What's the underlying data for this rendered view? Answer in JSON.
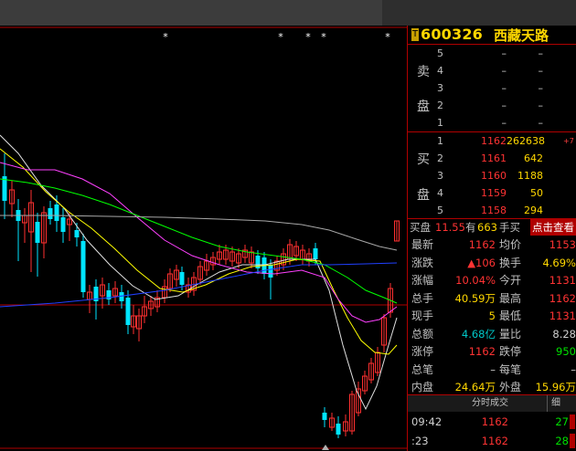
{
  "quote": {
    "flag": "T",
    "code": "600326",
    "name": "西藏天路",
    "sell_label_1": "卖",
    "sell_label_2": "盘",
    "buy_label_1": "买",
    "buy_label_2": "盘",
    "sell_levels": [
      {
        "n": "5",
        "price": "–",
        "vol": "–"
      },
      {
        "n": "4",
        "price": "–",
        "vol": "–"
      },
      {
        "n": "3",
        "price": "–",
        "vol": "–"
      },
      {
        "n": "2",
        "price": "–",
        "vol": "–"
      },
      {
        "n": "1",
        "price": "–",
        "vol": "–"
      }
    ],
    "buy_levels": [
      {
        "n": "1",
        "price": "1162",
        "vol": "262638",
        "chg": "+7"
      },
      {
        "n": "2",
        "price": "1161",
        "vol": "642",
        "chg": ""
      },
      {
        "n": "3",
        "price": "1160",
        "vol": "1188",
        "chg": ""
      },
      {
        "n": "4",
        "price": "1159",
        "vol": "50",
        "chg": ""
      },
      {
        "n": "5",
        "price": "1158",
        "vol": "294",
        "chg": ""
      }
    ],
    "buy_pan": {
      "label": "买盘",
      "value": "11.55",
      "has": "有",
      "count": "663",
      "unit": "手买",
      "button": "点击查看"
    },
    "stats": [
      {
        "l1": "最新",
        "v1": "1162",
        "c1": "red",
        "l2": "均价",
        "v2": "1153",
        "c2": "red"
      },
      {
        "l1": "涨跌",
        "v1": "▲106",
        "c1": "red",
        "l2": "换手",
        "v2": "4.69%",
        "c2": "yel"
      },
      {
        "l1": "涨幅",
        "v1": "10.04%",
        "c1": "red",
        "l2": "今开",
        "v2": "1131",
        "c2": "red"
      },
      {
        "l1": "总手",
        "v1": "40.59万",
        "c1": "yel",
        "l2": "最高",
        "v2": "1162",
        "c2": "red"
      },
      {
        "l1": "现手",
        "v1": "5",
        "c1": "yel",
        "l2": "最低",
        "v2": "1131",
        "c2": "red"
      },
      {
        "l1": "总额",
        "v1": "4.68亿",
        "c1": "cyan",
        "l2": "量比",
        "v2": "8.28",
        "c2": "wht"
      },
      {
        "l1": "涨停",
        "v1": "1162",
        "c1": "red",
        "l2": "跌停",
        "v2": "950",
        "c2": "grn"
      },
      {
        "l1": "总笔",
        "v1": "–",
        "c1": "wht",
        "l2": "每笔",
        "v2": "–",
        "c2": "wht"
      },
      {
        "l1": "内盘",
        "v1": "24.64万",
        "c1": "yel",
        "l2": "外盘",
        "v2": "15.96万",
        "c2": "yel"
      }
    ],
    "tabs": {
      "trades": "分时成交",
      "detail": "细"
    },
    "trades": [
      {
        "time": "09:42",
        "price": "1162",
        "vol": "27",
        "vol_color": "#00e000"
      },
      {
        "time": ":23",
        "price": "1162",
        "vol": "28",
        "vol_color": "#00e000"
      }
    ]
  },
  "chart_data": {
    "type": "candlestick",
    "stars": [
      "*",
      "*",
      "*",
      "*",
      "*"
    ],
    "colors": {
      "up": "#ff3030",
      "down": "#00e5ff",
      "ma_white": "#e0e0e0",
      "ma_yellow": "#ffff00",
      "ma_magenta": "#ff40ff",
      "ma_green": "#00ff00",
      "ma_gray": "#a8a8a8",
      "ma_blue": "#2040ff"
    }
  }
}
